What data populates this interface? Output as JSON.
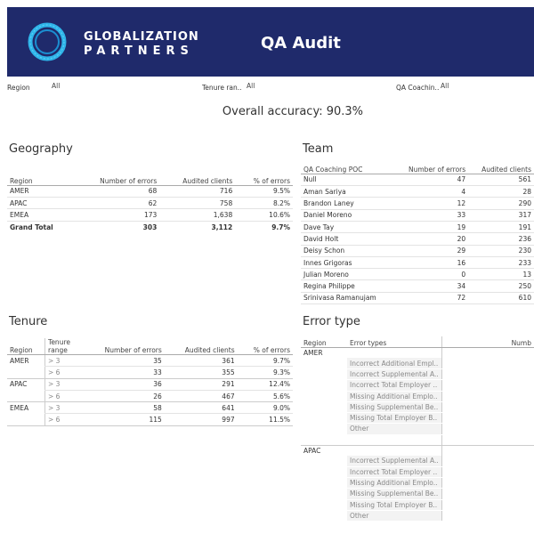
{
  "header": {
    "brand_line1": "GLOBALIZATION",
    "brand_line2": "PARTNERS",
    "title": "QA Audit",
    "logo_icon": "ring-logo-icon",
    "bg_color": "#1f2a6b"
  },
  "filters": {
    "region": {
      "label": "Region",
      "value": "All"
    },
    "tenure": {
      "label": "Tenure ran..",
      "value": "All"
    },
    "coach": {
      "label": "QA Coachin..",
      "value": "All"
    }
  },
  "overall_accuracy": "Overall accuracy: 90.3%",
  "geography": {
    "title": "Geography",
    "headers": [
      "Region",
      "Number of errors",
      "Audited clients",
      "% of errors"
    ],
    "rows": [
      [
        "AMER",
        "68",
        "716",
        "9.5%"
      ],
      [
        "APAC",
        "62",
        "758",
        "8.2%"
      ],
      [
        "EMEA",
        "173",
        "1,638",
        "10.6%"
      ]
    ],
    "total": [
      "Grand Total",
      "303",
      "3,112",
      "9.7%"
    ]
  },
  "team": {
    "title": "Team",
    "headers": [
      "QA Coaching POC",
      "Number of errors",
      "Audited clients"
    ],
    "rows": [
      [
        "Null",
        "47",
        "561"
      ],
      [
        "Aman Sariya",
        "4",
        "28"
      ],
      [
        "Brandon Laney",
        "12",
        "290"
      ],
      [
        "Daniel Moreno",
        "33",
        "317"
      ],
      [
        "Dave Tay",
        "19",
        "191"
      ],
      [
        "David Holt",
        "20",
        "236"
      ],
      [
        "Deisy Schon",
        "29",
        "230"
      ],
      [
        "Innes Grigoras",
        "16",
        "233"
      ],
      [
        "Julian Moreno",
        "0",
        "13"
      ],
      [
        "Regina Philippe",
        "34",
        "250"
      ],
      [
        "Srinivasa Ramanujam",
        "72",
        "610"
      ]
    ]
  },
  "tenure": {
    "title": "Tenure",
    "headers": [
      "Region",
      "Tenure range",
      "Number of errors",
      "Audited clients",
      "% of errors"
    ],
    "header_tenure_line1": "Tenure",
    "header_tenure_line2": "range",
    "rows": [
      [
        "AMER",
        "> 3",
        "35",
        "361",
        "9.7%"
      ],
      [
        "",
        "> 6",
        "33",
        "355",
        "9.3%"
      ],
      [
        "APAC",
        "> 3",
        "36",
        "291",
        "12.4%"
      ],
      [
        "",
        "> 6",
        "26",
        "467",
        "5.6%"
      ],
      [
        "EMEA",
        "> 3",
        "58",
        "641",
        "9.0%"
      ],
      [
        "",
        "> 6",
        "115",
        "997",
        "11.5%"
      ]
    ]
  },
  "error_type": {
    "title": "Error type",
    "headers": [
      "Region",
      "Error types",
      "Numb"
    ],
    "groups": [
      {
        "region": "AMER",
        "items": [
          "Incorrect Additional Empl..",
          "Incorrect Supplemental A..",
          "Incorrect Total Employer ..",
          "Missing Additional Emplo..",
          "Missing Supplemental Be..",
          "Missing Total Employer B..",
          "Other"
        ]
      },
      {
        "region": "APAC",
        "items": [
          "Incorrect Supplemental A..",
          "Incorrect Total Employer ..",
          "Missing Additional Emplo..",
          "Missing Supplemental Be..",
          "Missing Total Employer B..",
          "Other"
        ]
      }
    ]
  }
}
